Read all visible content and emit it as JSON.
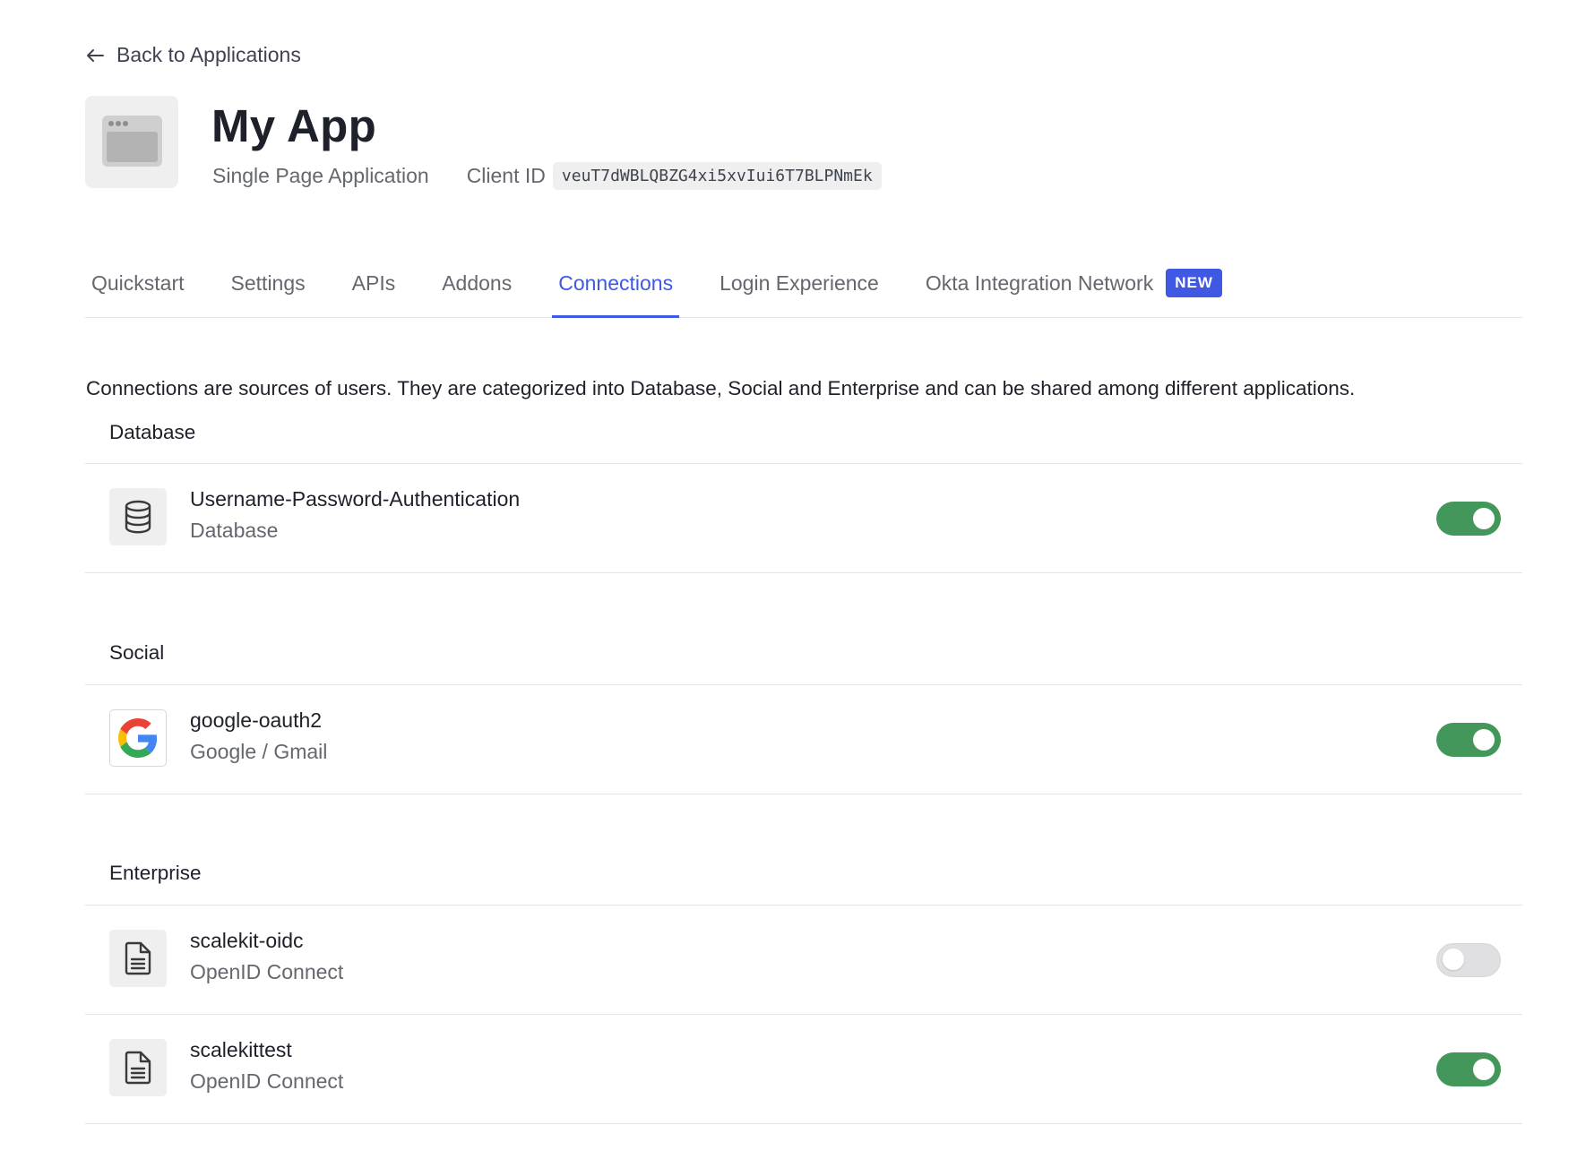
{
  "header": {
    "back_link": "Back to Applications",
    "app_name": "My App",
    "app_type": "Single Page Application",
    "client_id_label": "Client ID",
    "client_id_value": "veuT7dWBLQBZG4xi5xvIui6T7BLPNmEk"
  },
  "tabs": [
    {
      "label": "Quickstart",
      "active": false
    },
    {
      "label": "Settings",
      "active": false
    },
    {
      "label": "APIs",
      "active": false
    },
    {
      "label": "Addons",
      "active": false
    },
    {
      "label": "Connections",
      "active": true
    },
    {
      "label": "Login Experience",
      "active": false
    },
    {
      "label": "Okta Integration Network",
      "active": false,
      "badge": "NEW"
    }
  ],
  "intro": "Connections are sources of users. They are categorized into Database, Social and Enterprise and can be shared among different applications.",
  "sections": {
    "database": {
      "title": "Database",
      "connections": [
        {
          "name": "Username-Password-Authentication",
          "type": "Database",
          "icon": "database-icon",
          "enabled": true
        }
      ]
    },
    "social": {
      "title": "Social",
      "connections": [
        {
          "name": "google-oauth2",
          "type": "Google / Gmail",
          "icon": "google-icon",
          "enabled": true
        }
      ]
    },
    "enterprise": {
      "title": "Enterprise",
      "connections": [
        {
          "name": "scalekit-oidc",
          "type": "OpenID Connect",
          "icon": "document-icon",
          "enabled": false
        },
        {
          "name": "scalekittest",
          "type": "OpenID Connect",
          "icon": "document-icon",
          "enabled": true
        }
      ]
    }
  },
  "colors": {
    "accent": "#3f59e4",
    "toggle_on": "#44975a",
    "toggle_off": "#e0e0e2"
  }
}
